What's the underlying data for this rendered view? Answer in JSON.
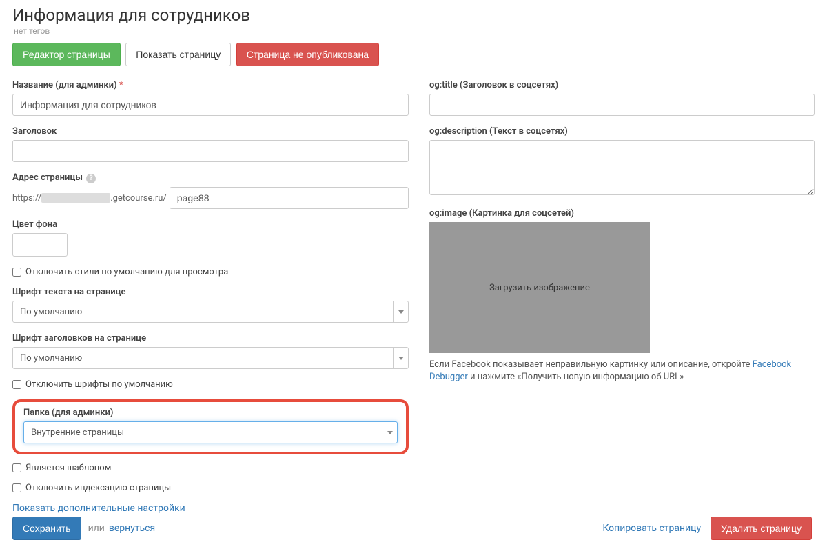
{
  "header": {
    "title": "Информация для сотрудников",
    "no_tags": "нет тегов"
  },
  "buttons": {
    "editor": "Редактор страницы",
    "show": "Показать страницу",
    "unpublished": "Страница не опубликована"
  },
  "left": {
    "name_label": "Название (для админки)",
    "name_value": "Информация для сотрудников",
    "heading_label": "Заголовок",
    "heading_value": "",
    "address_label": "Адрес страницы",
    "url_prefix": "https://",
    "url_suffix": ".getcourse.ru/",
    "slug_value": "page88",
    "bgcolor_label": "Цвет фона",
    "disable_styles": "Отключить стили по умолчанию для просмотра",
    "text_font_label": "Шрифт текста на странице",
    "text_font_value": "По умолчанию",
    "heading_font_label": "Шрифт заголовков на странице",
    "heading_font_value": "По умолчанию",
    "disable_fonts": "Отключить шрифты по умолчанию",
    "folder_label": "Папка (для админки)",
    "folder_value": "Внутренние страницы",
    "is_template": "Является шаблоном",
    "disable_index": "Отключить индексацию страницы",
    "show_more": "Показать дополнительные настройки"
  },
  "right": {
    "og_title_label": "og:title (Заголовок в соцсетях)",
    "og_title_value": "",
    "og_desc_label": "og:description (Текст в соцсетях)",
    "og_desc_value": "",
    "og_image_label": "og:image (Картинка для соцсетей)",
    "og_image_upload": "Загрузить изображение",
    "og_hint_prefix": "Если Facebook показывает неправильную картинку или описание, откройте ",
    "og_hint_link": "Facebook Debugger",
    "og_hint_suffix": " и нажмите «Получить новую информацию об URL»"
  },
  "footer": {
    "save": "Сохранить",
    "or": "или",
    "back": "вернуться",
    "copy": "Копировать страницу",
    "delete": "Удалить страницу"
  }
}
